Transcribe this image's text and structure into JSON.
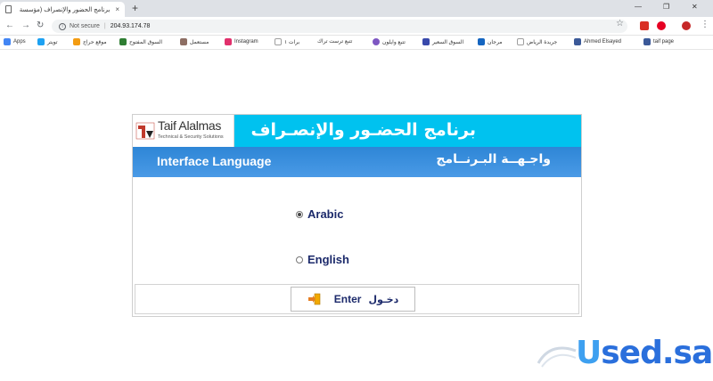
{
  "browser": {
    "tab_title": "برنامج الحضور والإنصراف (مؤسسة",
    "tab_close": "×",
    "new_tab": "+",
    "address_security": "Not secure",
    "address_url": "204.93.174.78",
    "bookmarks": [
      {
        "label": "Apps",
        "color": "#4285f4"
      },
      {
        "label": "تويتر",
        "color": "#1da1f2"
      },
      {
        "label": "موقع حراج",
        "color": "#f39c12"
      },
      {
        "label": "السوق المفتوح",
        "color": "#2e7d32"
      },
      {
        "label": "مستعمل",
        "color": "#8d6e63"
      },
      {
        "label": "Instagram",
        "color": "#e1306c"
      },
      {
        "label": "برات ١",
        "color": "#9e9e9e"
      },
      {
        "label": "تتبع ترست تراك",
        "color": "#9e9e9e"
      },
      {
        "label": "تتبع وايلون",
        "color": "#7e57c2"
      },
      {
        "label": "السوق السعير",
        "color": "#3949ab"
      },
      {
        "label": "مرجان",
        "color": "#1565c0"
      },
      {
        "label": "جريدة الرياض",
        "color": "#9e9e9e"
      },
      {
        "label": "Ahmed Elsayed",
        "color": "#3b5998"
      },
      {
        "label": "taif page",
        "color": "#3b5998"
      }
    ]
  },
  "app": {
    "logo_name": "Taif Alalmas",
    "logo_subtitle": "Technical & Security Solutions",
    "title_ar": "برنامج الحضـور والإنصـراف",
    "interface_language_en": "Interface Language",
    "interface_language_ar": "واجـهــة البـرنــامج",
    "languages": [
      {
        "label": "Arabic",
        "checked": true
      },
      {
        "label": "English",
        "checked": false
      }
    ],
    "enter_en": "Enter",
    "enter_ar": "دخـول"
  },
  "watermark": {
    "text_a": "U",
    "text_b": "sed.sa"
  },
  "colors": {
    "header_cyan": "#00c2ef",
    "header_blue": "#3a8fe0",
    "label_navy": "#1c2a6b"
  }
}
